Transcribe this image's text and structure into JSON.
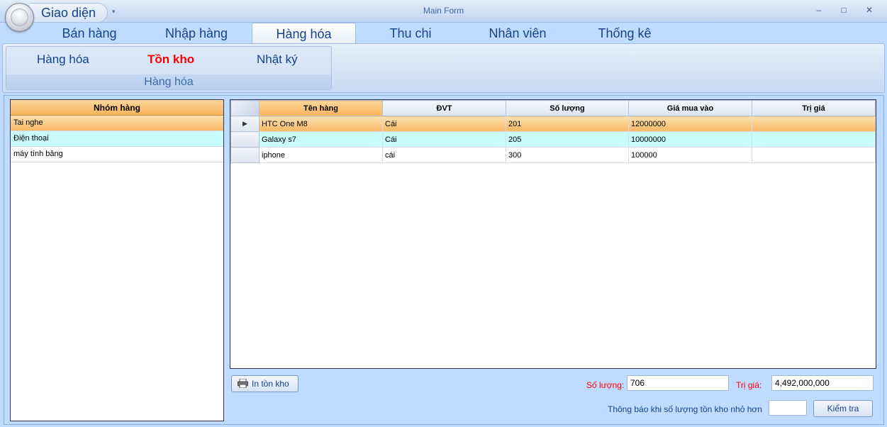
{
  "app": {
    "qat_title": "Giao diện",
    "window_title": "Main Form",
    "controls": {
      "minimize": "–",
      "maximize": "□",
      "close": "✕"
    }
  },
  "tabs": [
    {
      "label": "Bán hàng"
    },
    {
      "label": "Nhập hàng"
    },
    {
      "label": "Hàng hóa",
      "active": true
    },
    {
      "label": "Thu chi"
    },
    {
      "label": "Nhân viên"
    },
    {
      "label": "Thống kê"
    }
  ],
  "ribbon": {
    "group_label": "Hàng hóa",
    "buttons": [
      {
        "label": "Hàng hóa"
      },
      {
        "label": "Tồn kho",
        "active": true
      },
      {
        "label": "Nhật ký"
      }
    ]
  },
  "groups": {
    "header": "Nhóm hàng",
    "items": [
      "Tai nghe",
      "Điện thoại",
      "máy tính bảng"
    ]
  },
  "grid": {
    "columns": [
      "Tên hàng",
      "ĐVT",
      "Số lượng",
      "Giá mua vào",
      "Trị giá"
    ],
    "rows": [
      [
        "HTC One M8",
        "Cái",
        "201",
        "12000000",
        ""
      ],
      [
        "Galaxy s7",
        "Cái",
        "205",
        "10000000",
        ""
      ],
      [
        "iphone",
        "cái",
        "300",
        "100000",
        ""
      ]
    ]
  },
  "footer": {
    "print_label": "In tồn kho",
    "qty_label": "Số lượng:",
    "qty_value": "706",
    "value_label": "Trị giá:",
    "value_value": "4,492,000,000",
    "notify_label": "Thông báo khi số lượng tồn kho nhỏ hơn",
    "notify_value": "",
    "check_label": "Kiểm tra"
  },
  "colors": {
    "accent": "#15428b",
    "highlight_red": "#ff0000",
    "selection_orange": "#f9b764",
    "alt_row_cyan": "#c9fbfb"
  }
}
